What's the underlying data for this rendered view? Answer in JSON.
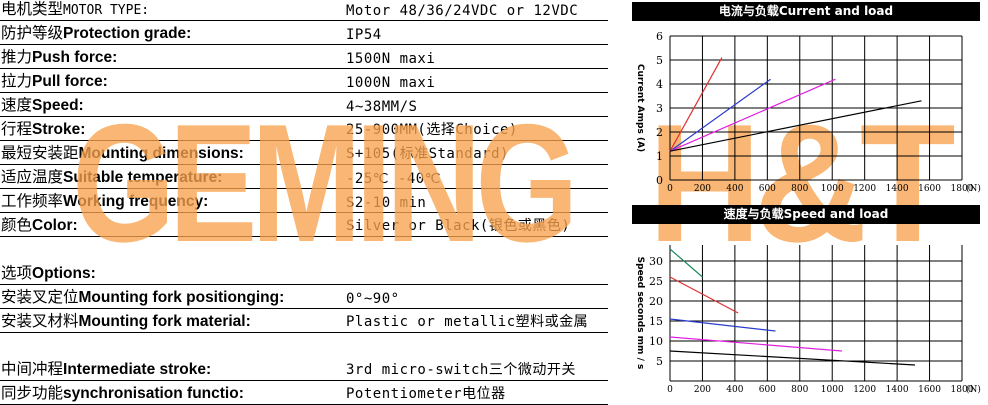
{
  "specs": [
    {
      "cn": "电机类型",
      "en": "",
      "en_mono": "MOTOR TYPE:",
      "value": "Motor 48/36/24VDC or 12VDC"
    },
    {
      "cn": "防护等级",
      "en": "Protection grade:",
      "en_mono": "",
      "value": "IP54"
    },
    {
      "cn": "推力",
      "en": "Push force:",
      "en_mono": "",
      "value": "1500N maxi"
    },
    {
      "cn": "拉力",
      "en": "Pull force:",
      "en_mono": "",
      "value": "1000N maxi"
    },
    {
      "cn": "速度",
      "en": "Speed:",
      "en_mono": "",
      "value": "4~38MM/S"
    },
    {
      "cn": "行程",
      "en": "Stroke:",
      "en_mono": "",
      "value": "25-900MM(选择Choice)"
    },
    {
      "cn": "最短安装距",
      "en": "Mounting dimensions:",
      "en_mono": "",
      "value": "S+105(标准Standard)"
    },
    {
      "cn": "适应温度",
      "en": "Suitable temperature:",
      "en_mono": "",
      "value": "-25℃ -40℃"
    },
    {
      "cn": "工作频率",
      "en": "Working frequency:",
      "en_mono": "",
      "value": "S2-10 min"
    },
    {
      "cn": "颜色",
      "en": "Color:",
      "en_mono": "",
      "value": "Silver or Black(银色或黑色)"
    },
    {
      "cn": "选项",
      "en": "Options:",
      "en_mono": "",
      "value": ""
    },
    {
      "cn": "安装叉定位",
      "en": "Mounting fork positionging:",
      "en_mono": "",
      "value": "0°~90°"
    },
    {
      "cn": "安装叉材料",
      "en": "Mounting fork material:",
      "en_mono": "",
      "value": "Plastic or metallic塑料或金属"
    },
    {
      "cn": "中间冲程",
      "en": "Intermediate stroke:",
      "en_mono": "",
      "value": "3rd micro-switch三个微动开关"
    },
    {
      "cn": "同步功能",
      "en": "synchronisation functio:",
      "en_mono": "",
      "value": "Potentiometer电位器"
    }
  ],
  "watermark": {
    "left": "GEMING",
    "right": "H&T",
    "color": "#f8a24e"
  },
  "chart_data": [
    {
      "type": "line",
      "title": "电流与负载Current and load",
      "ylabel": "Current Amps (A)",
      "xlabel": "(N)",
      "x_ticks": [
        "0",
        "200",
        "400",
        "600",
        "800",
        "1000",
        "1200",
        "1400",
        "1600",
        "1800"
      ],
      "y_ticks": [
        "0",
        "1",
        "2",
        "3",
        "4",
        "5",
        "6"
      ],
      "xlim": [
        0,
        1800
      ],
      "ylim": [
        0,
        6
      ],
      "grid": true,
      "series": [
        {
          "color": "#e03030",
          "x": [
            0,
            320
          ],
          "y": [
            1.2,
            5.1
          ]
        },
        {
          "color": "#2a3ccc",
          "x": [
            0,
            620
          ],
          "y": [
            1.2,
            4.2
          ]
        },
        {
          "color": "#e020e0",
          "x": [
            0,
            1020
          ],
          "y": [
            1.2,
            4.2
          ]
        },
        {
          "color": "#000000",
          "x": [
            0,
            1550
          ],
          "y": [
            1.2,
            3.3
          ]
        }
      ]
    },
    {
      "type": "line",
      "title": "速度与负载Speed and load",
      "ylabel": "Speed seconds mm / s",
      "xlabel": "(N)",
      "x_ticks": [
        "0",
        "200",
        "400",
        "600",
        "800",
        "1000",
        "1200",
        "1400",
        "1600",
        "1800"
      ],
      "y_ticks": [
        "5",
        "10",
        "15",
        "20",
        "25",
        "30"
      ],
      "xlim": [
        0,
        1800
      ],
      "ylim": [
        0,
        34
      ],
      "grid": true,
      "series": [
        {
          "color": "#1a8a5a",
          "x": [
            0,
            200
          ],
          "y": [
            33,
            26
          ]
        },
        {
          "color": "#e03030",
          "x": [
            0,
            420
          ],
          "y": [
            26,
            17
          ]
        },
        {
          "color": "#2a3ccc",
          "x": [
            0,
            650
          ],
          "y": [
            15.5,
            12.5
          ]
        },
        {
          "color": "#e020e0",
          "x": [
            0,
            1060
          ],
          "y": [
            11,
            7.5
          ]
        },
        {
          "color": "#000000",
          "x": [
            0,
            1510
          ],
          "y": [
            7.5,
            4
          ]
        }
      ]
    }
  ]
}
